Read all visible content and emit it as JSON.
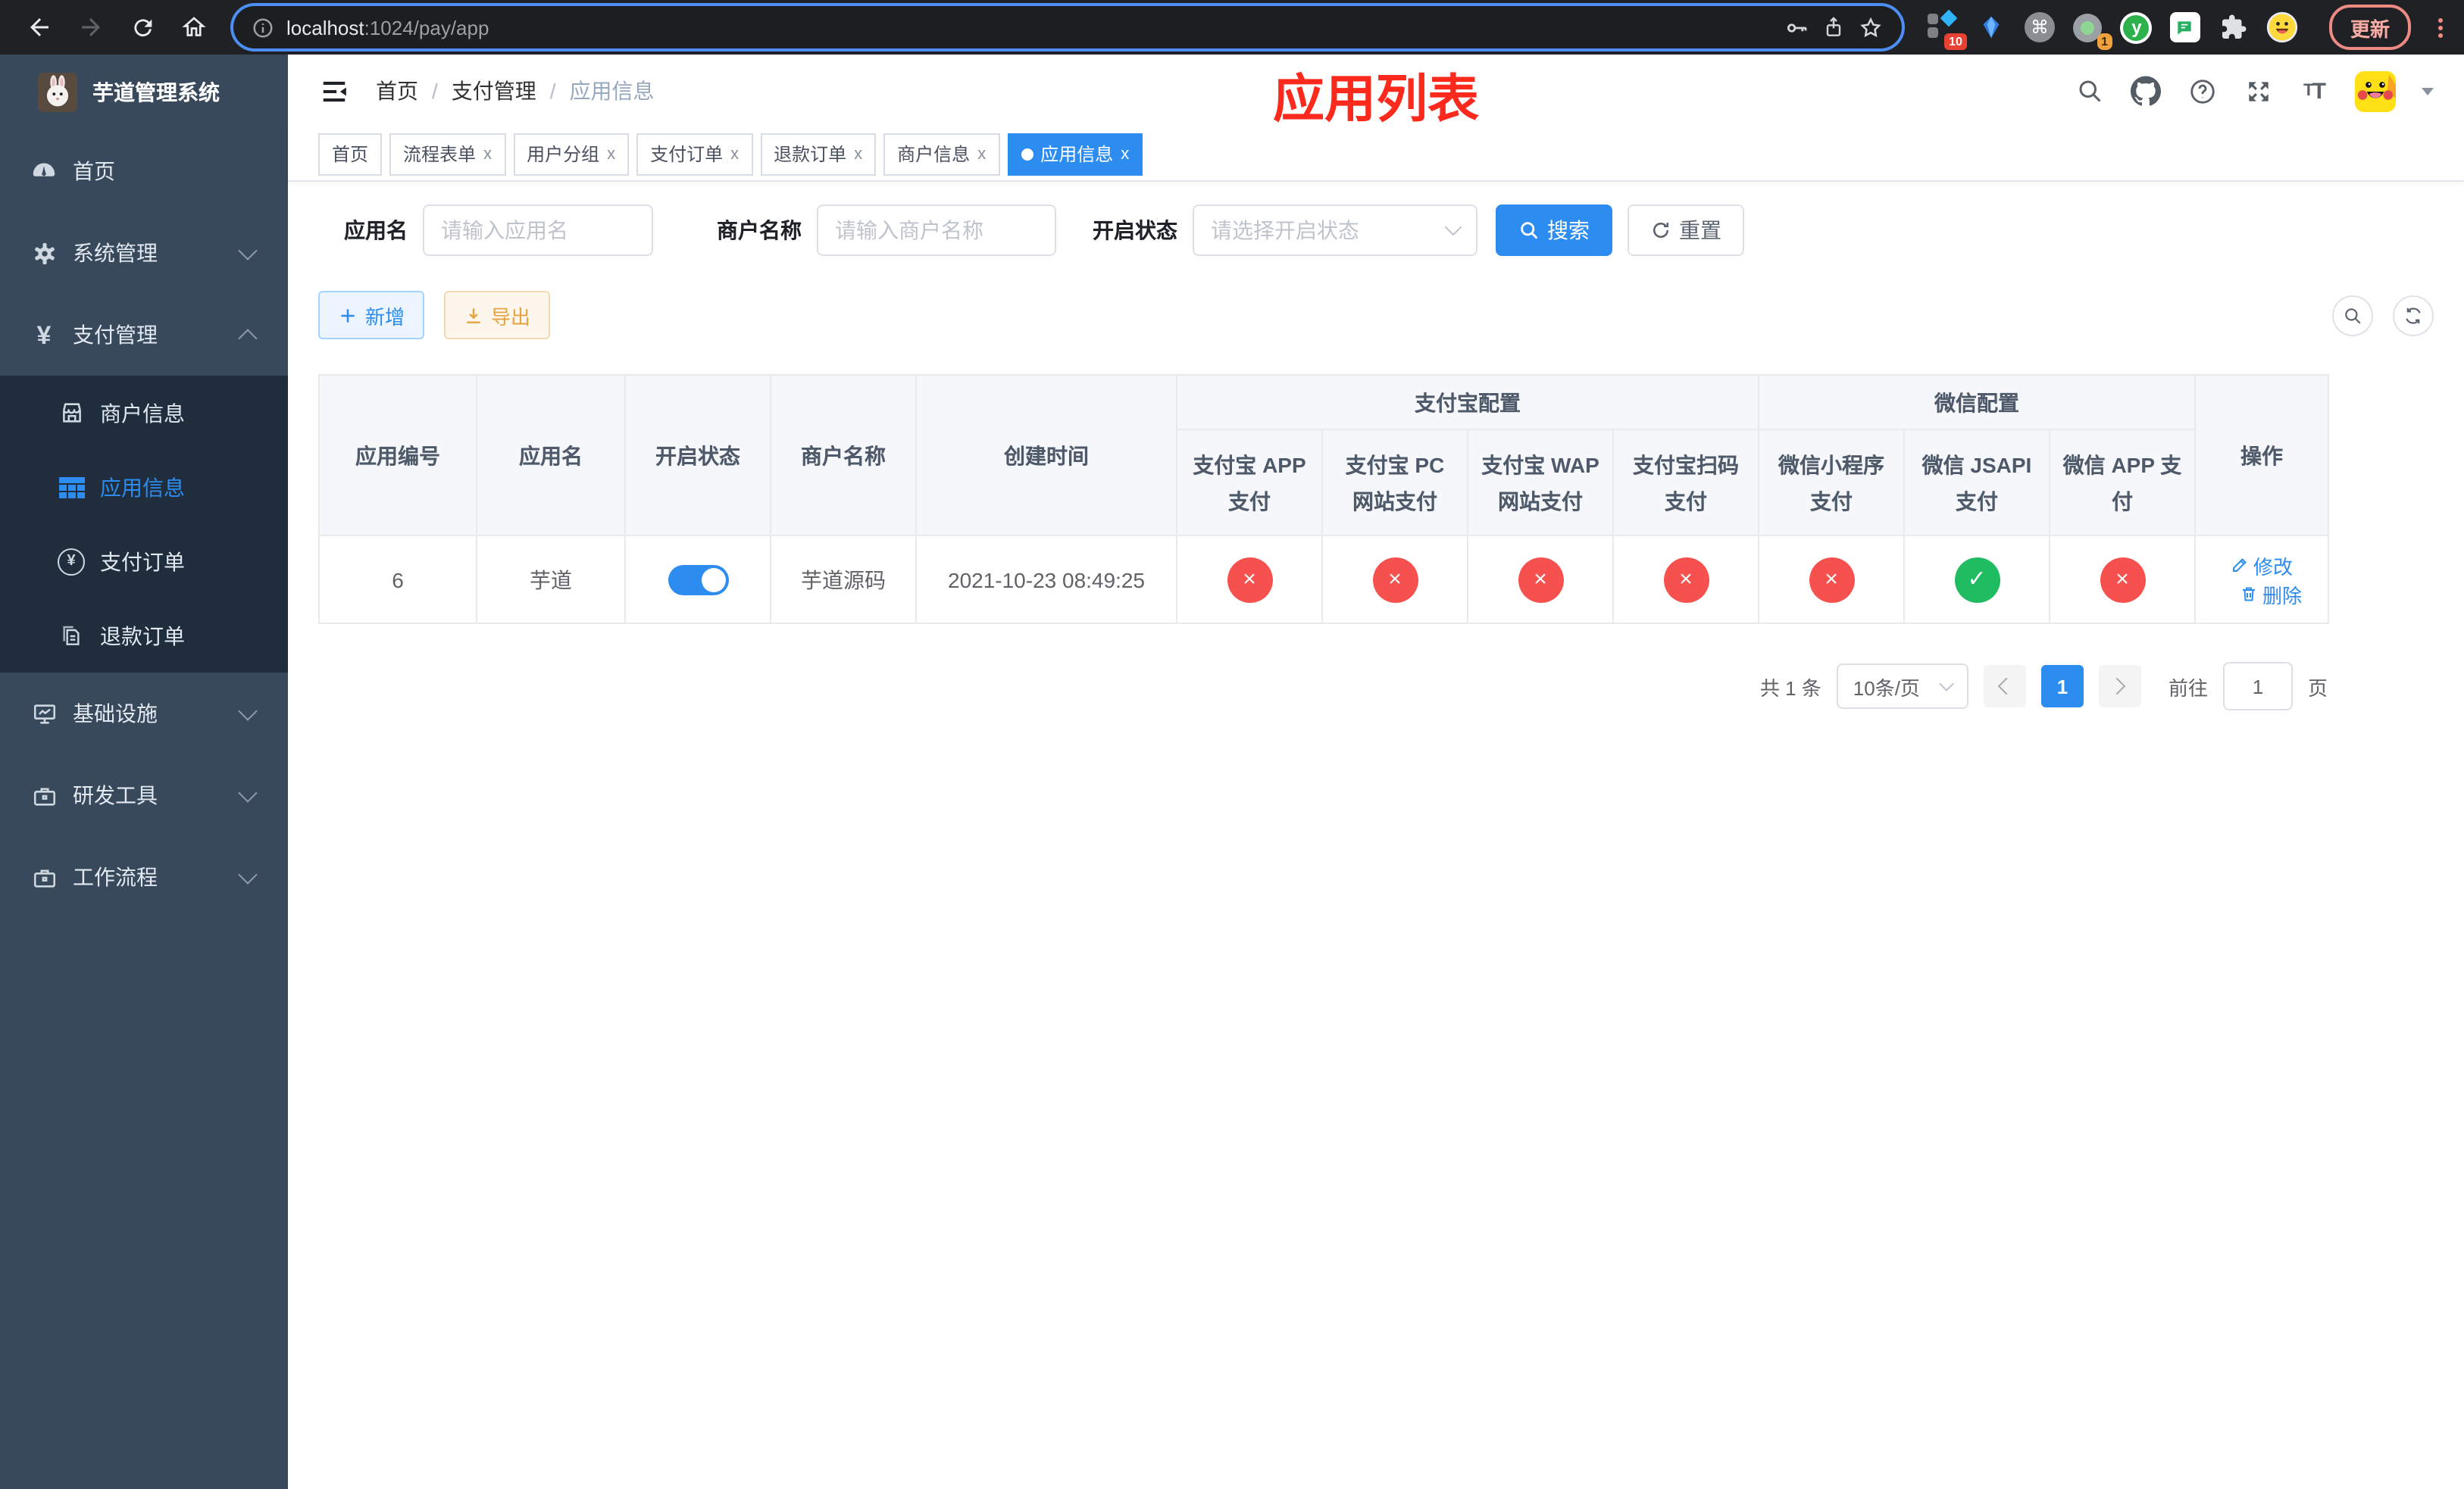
{
  "colors": {
    "accent": "#2d8cf0",
    "danger": "#f6514e",
    "success": "#20bc62",
    "warning": "#e6a23c",
    "annotation": "#fb2a1d",
    "sidebar": "#39495c",
    "submenu": "#1f2d3d"
  },
  "browser": {
    "url_host": "localhost",
    "url_path": ":1024/pay/app",
    "update_label": "更新",
    "ext_badge_1": "10",
    "ext_badge_2": "1",
    "command_glyph": "⌘",
    "y_glyph": "y"
  },
  "sidebar": {
    "title": "芋道管理系统",
    "menu": [
      {
        "label": "首页"
      },
      {
        "label": "系统管理"
      },
      {
        "label": "支付管理"
      },
      {
        "label": "商户信息"
      },
      {
        "label": "应用信息"
      },
      {
        "label": "支付订单"
      },
      {
        "label": "退款订单"
      },
      {
        "label": "基础设施"
      },
      {
        "label": "研发工具"
      },
      {
        "label": "工作流程"
      }
    ],
    "yen_glyph": "¥"
  },
  "header": {
    "breadcrumb": [
      "首页",
      "支付管理",
      "应用信息"
    ],
    "separator": "/",
    "annotation": "应用列表",
    "font_icon": "T"
  },
  "tabs": [
    {
      "label": "首页"
    },
    {
      "label": "流程表单",
      "close": "x"
    },
    {
      "label": "用户分组",
      "close": "x"
    },
    {
      "label": "支付订单",
      "close": "x"
    },
    {
      "label": "退款订单",
      "close": "x"
    },
    {
      "label": "商户信息",
      "close": "x"
    },
    {
      "label": "应用信息",
      "close": "x",
      "active": true
    }
  ],
  "filters": {
    "app_name_label": "应用名",
    "app_name_placeholder": "请输入应用名",
    "merchant_label": "商户名称",
    "merchant_placeholder": "请输入商户名称",
    "status_label": "开启状态",
    "status_placeholder": "请选择开启状态",
    "search_label": "搜索",
    "reset_label": "重置"
  },
  "toolbar": {
    "add_label": "新增",
    "export_label": "导出"
  },
  "table": {
    "columns": [
      "应用编号",
      "应用名",
      "开启状态",
      "商户名称",
      "创建时间"
    ],
    "groups": [
      {
        "label": "支付宝配置",
        "children": [
          "支付宝 APP 支付",
          "支付宝 PC 网站支付",
          "支付宝 WAP 网站支付",
          "支付宝扫码支付"
        ]
      },
      {
        "label": "微信配置",
        "children": [
          "微信小程序支付",
          "微信 JSAPI 支付",
          "微信 APP 支付"
        ]
      }
    ],
    "actions_label": "操作",
    "rows": [
      {
        "id": "6",
        "name": "芋道",
        "enabled": true,
        "merchant": "芋道源码",
        "created": "2021-10-23 08:49:25",
        "configs": [
          false,
          false,
          false,
          false,
          false,
          true,
          false
        ],
        "actions": [
          "修改",
          "删除"
        ]
      }
    ]
  },
  "pagination": {
    "total_text": "共 1 条",
    "page_size": "10条/页",
    "current_page": "1",
    "goto_label": "前往",
    "goto_value": "1",
    "page_suffix": "页"
  }
}
